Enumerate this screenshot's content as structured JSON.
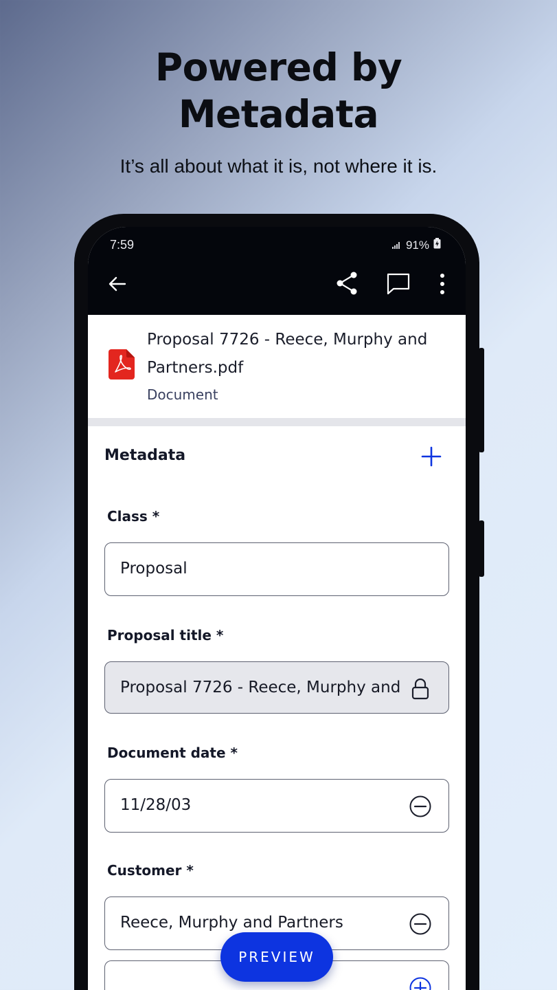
{
  "promo": {
    "headline_line1": "Powered by",
    "headline_line2": "Metadata",
    "subline": "It’s all about what it is, not where it is."
  },
  "status_bar": {
    "time": "7:59",
    "battery": "91%"
  },
  "toolbar": {
    "back_icon": "arrow-left-icon",
    "share_icon": "share-icon",
    "comment_icon": "comment-icon",
    "more_icon": "more-vertical-icon"
  },
  "file": {
    "name": "Proposal 7726 - Reece, Murphy and Partners.pdf",
    "type": "Document",
    "icon": "pdf-icon"
  },
  "metadata": {
    "section_title": "Metadata",
    "fields": [
      {
        "label": "Class *",
        "value": "Proposal"
      },
      {
        "label": "Proposal title *",
        "value": "Proposal 7726 - Reece, Murphy and",
        "locked": true
      },
      {
        "label": "Document date *",
        "value": "11/28/03"
      },
      {
        "label": "Customer *",
        "value": "Reece, Murphy and Partners"
      }
    ]
  },
  "actions": {
    "preview_label": "PREVIEW"
  },
  "colors": {
    "accent": "#0d34e0",
    "topbar": "#04060c",
    "pdf_red": "#e3261f"
  }
}
